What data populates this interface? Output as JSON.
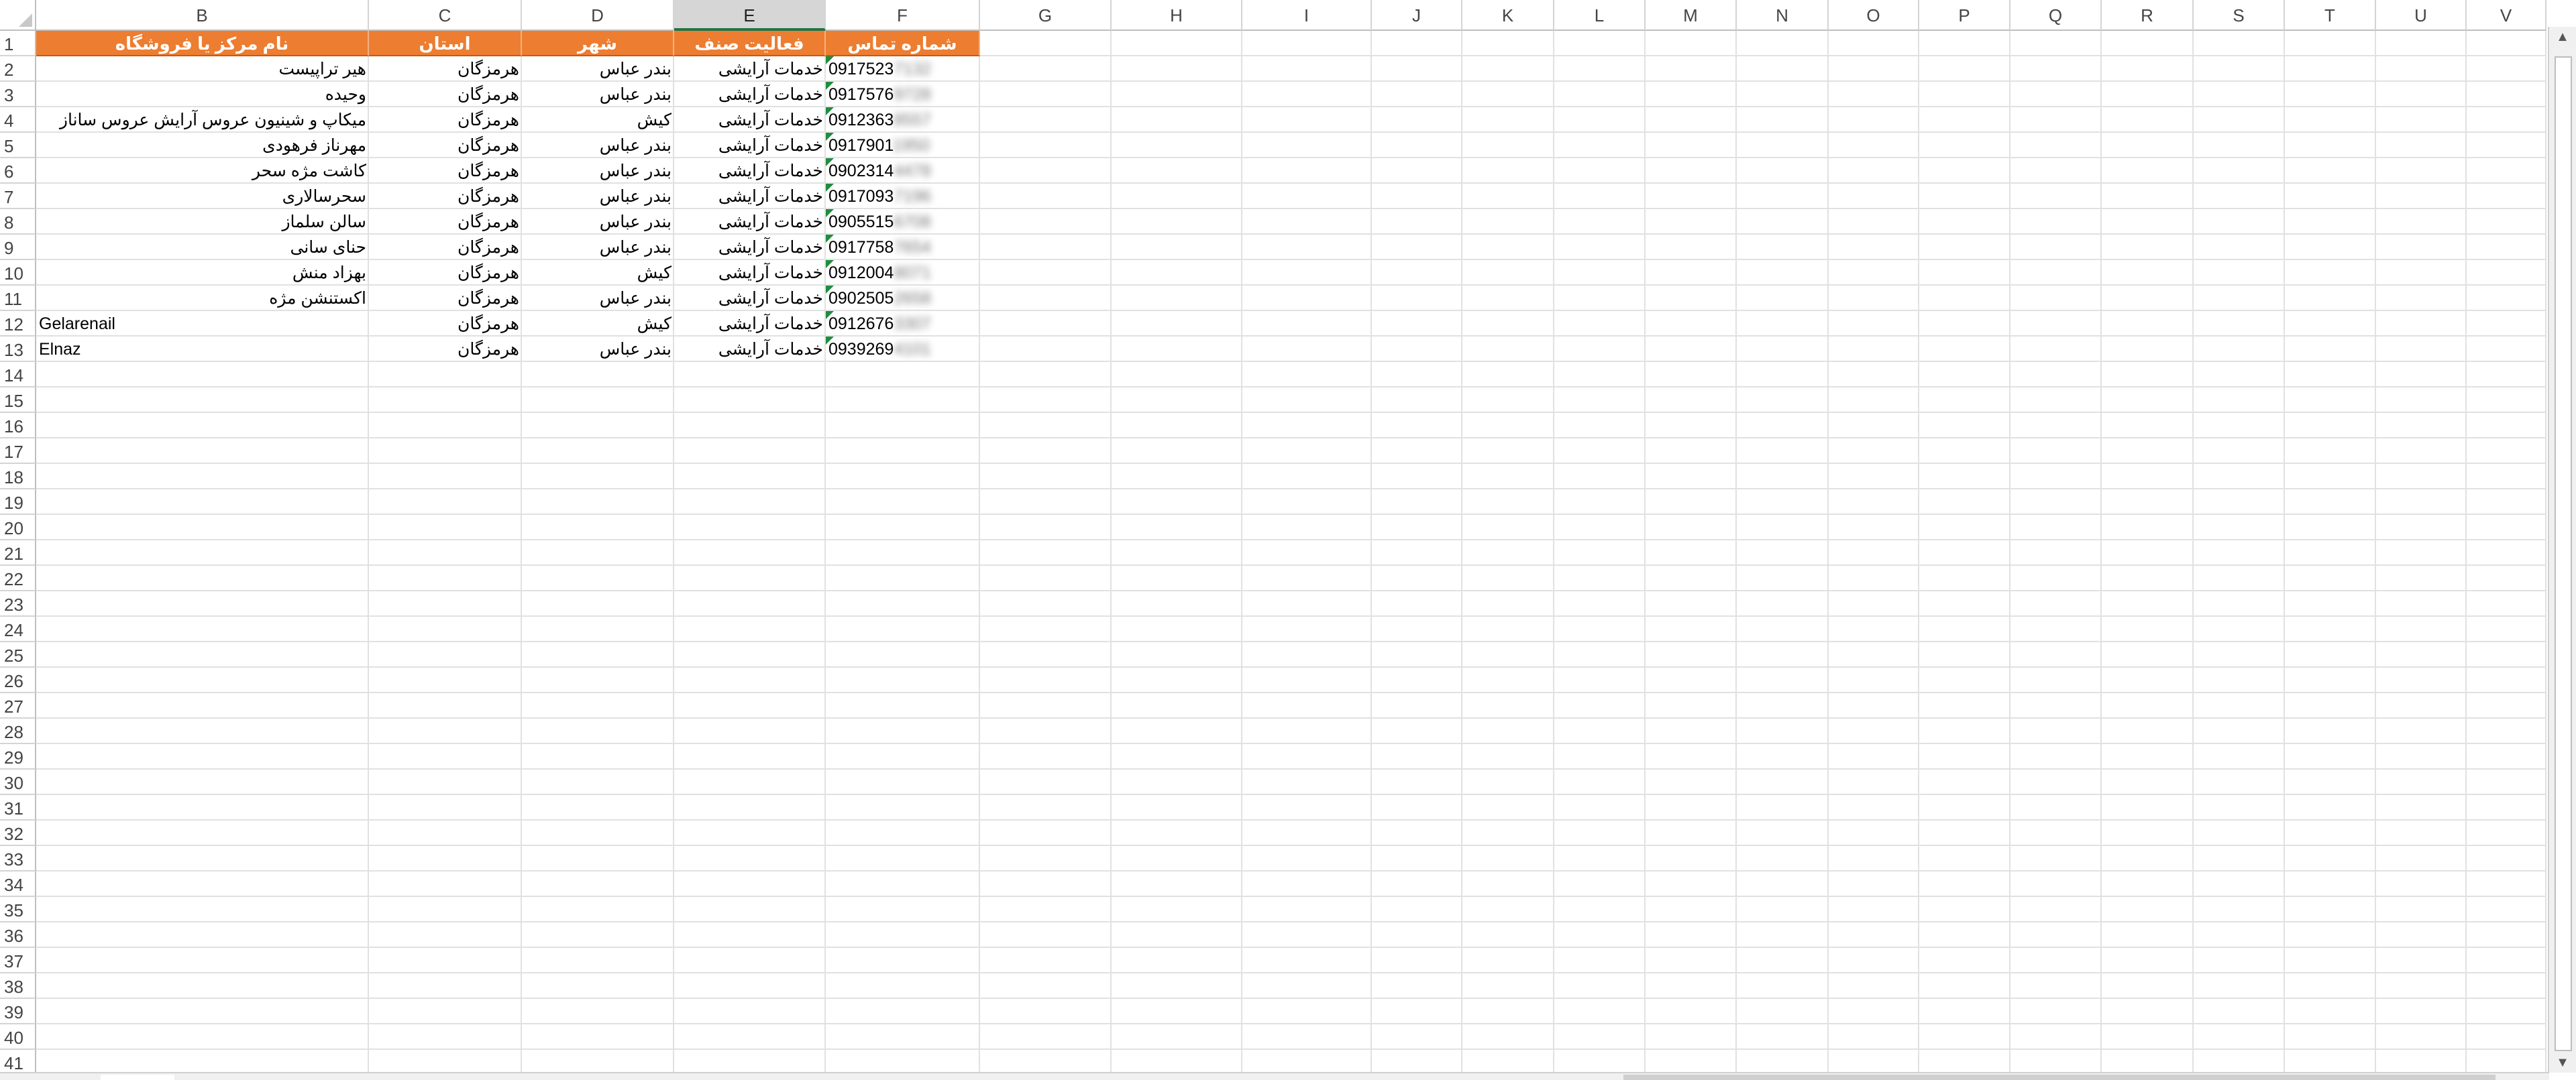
{
  "columns": [
    "B",
    "C",
    "D",
    "E",
    "F",
    "G",
    "H",
    "I",
    "J",
    "K",
    "L",
    "M",
    "N",
    "O",
    "P",
    "Q",
    "R",
    "S",
    "T",
    "U",
    "V"
  ],
  "rows": [
    "1",
    "2",
    "3",
    "4",
    "5",
    "6",
    "7",
    "8",
    "9",
    "10",
    "11",
    "12",
    "13",
    "14",
    "15",
    "16",
    "17",
    "18",
    "19",
    "20",
    "21",
    "22",
    "23",
    "24",
    "25",
    "26",
    "27",
    "28",
    "29",
    "30",
    "31",
    "32",
    "33",
    "34",
    "35",
    "36",
    "37",
    "38",
    "39",
    "40",
    "41"
  ],
  "header": {
    "B": "نام مرکز یا فروشگاه",
    "C": "استان",
    "D": "شهر",
    "E": "فعالیت صنف",
    "F": "شماره تماس"
  },
  "selected_column": "E",
  "table": [
    {
      "name": "هیر تراپیست",
      "province": "هرمزگان",
      "city": "بندر عباس",
      "activity": "خدمات آرایشی",
      "phone_visible": "0917523",
      "phone_hidden": "7132"
    },
    {
      "name": "وحیده",
      "province": "هرمزگان",
      "city": "بندر عباس",
      "activity": "خدمات آرایشی",
      "phone_visible": "0917576",
      "phone_hidden": "9728"
    },
    {
      "name": "میکاپ و شینیون عروس آرایش عروس ساناز",
      "province": "هرمزگان",
      "city": "کیش",
      "activity": "خدمات آرایشی",
      "phone_visible": "0912363",
      "phone_hidden": "8557"
    },
    {
      "name": "مهرناز فرهودی",
      "province": "هرمزگان",
      "city": "بندر عباس",
      "activity": "خدمات آرایشی",
      "phone_visible": "0917901",
      "phone_hidden": "1950"
    },
    {
      "name": "کاشت مژه سحر",
      "province": "هرمزگان",
      "city": "بندر عباس",
      "activity": "خدمات آرایشی",
      "phone_visible": "0902314",
      "phone_hidden": "4478"
    },
    {
      "name": "سحرسالاری",
      "province": "هرمزگان",
      "city": "بندر عباس",
      "activity": "خدمات آرایشی",
      "phone_visible": "0917093",
      "phone_hidden": "7196"
    },
    {
      "name": "سالن سلماز",
      "province": "هرمزگان",
      "city": "بندر عباس",
      "activity": "خدمات آرایشی",
      "phone_visible": "0905515",
      "phone_hidden": "6708"
    },
    {
      "name": "حنای سانی",
      "province": "هرمزگان",
      "city": "بندر عباس",
      "activity": "خدمات آرایشی",
      "phone_visible": "0917758",
      "phone_hidden": "7654"
    },
    {
      "name": "بهزاد منش",
      "province": "هرمزگان",
      "city": "کیش",
      "activity": "خدمات آرایشی",
      "phone_visible": "0912004",
      "phone_hidden": "8071"
    },
    {
      "name": "اکستنشن مژه",
      "province": "هرمزگان",
      "city": "بندر عباس",
      "activity": "خدمات آرایشی",
      "phone_visible": "0902505",
      "phone_hidden": "2658"
    },
    {
      "name": "Gelarenail",
      "province": "هرمزگان",
      "city": "کیش",
      "activity": "خدمات آرایشی",
      "phone_visible": "0912676",
      "phone_hidden": "3307"
    },
    {
      "name": "Elnaz",
      "province": "هرمزگان",
      "city": "بندر عباس",
      "activity": "خدمات آرایشی",
      "phone_visible": "0939269",
      "phone_hidden": "4101"
    }
  ],
  "colors": {
    "header_fill": "#ed7d31",
    "header_text": "#ffffff",
    "selection": "#217346",
    "comment_flag": "#1e8e3e"
  }
}
